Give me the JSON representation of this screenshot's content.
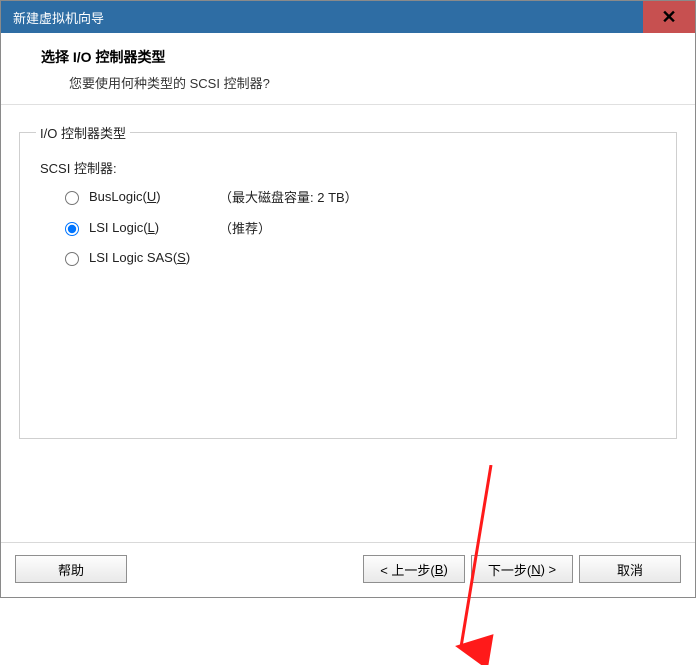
{
  "window": {
    "title": "新建虚拟机向导",
    "close_glyph": "✕"
  },
  "header": {
    "heading": "选择 I/O 控制器类型",
    "subheading": "您要使用何种类型的 SCSI 控制器?"
  },
  "group": {
    "legend": "I/O 控制器类型",
    "scsi_label": "SCSI 控制器:",
    "options": [
      {
        "label_pre": "BusLogic(",
        "mnemonic": "U",
        "label_post": ")",
        "hint": "（最大磁盘容量: 2 TB）",
        "selected": false
      },
      {
        "label_pre": "LSI Logic(",
        "mnemonic": "L",
        "label_post": ")",
        "hint": "（推荐）",
        "selected": true
      },
      {
        "label_pre": "LSI Logic SAS(",
        "mnemonic": "S",
        "label_post": ")",
        "hint": "",
        "selected": false
      }
    ]
  },
  "footer": {
    "help": "帮助",
    "back_pre": "< 上一步(",
    "back_m": "B",
    "back_post": ")",
    "next_pre": "下一步(",
    "next_m": "N",
    "next_post": ") >",
    "cancel": "取消"
  }
}
